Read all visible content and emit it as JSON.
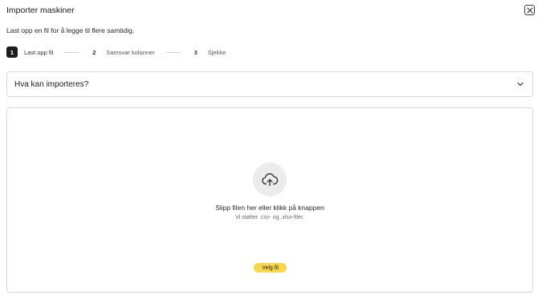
{
  "dialog": {
    "title": "Importer maskiner",
    "subtitle": "Last opp en fil for å legge til flere samtidig."
  },
  "stepper": {
    "steps": [
      {
        "number": "1",
        "label": "Last opp fil",
        "active": true
      },
      {
        "number": "2",
        "label": "Samsvar kolonner",
        "active": false
      },
      {
        "number": "3",
        "label": "Sjekke",
        "active": false
      }
    ]
  },
  "accordion": {
    "title": "Hva kan importeres?"
  },
  "dropzone": {
    "icon": "cloud-upload-icon",
    "main_text": "Slipp filen her eller klikk på knappen",
    "sub_text": "Vi støtter .csv- og .xlsx-filer.",
    "button_label": "Velg fil"
  },
  "colors": {
    "accent": "#f6d84a",
    "active_step": "#1c1c1c",
    "border": "#d8d8d8"
  }
}
